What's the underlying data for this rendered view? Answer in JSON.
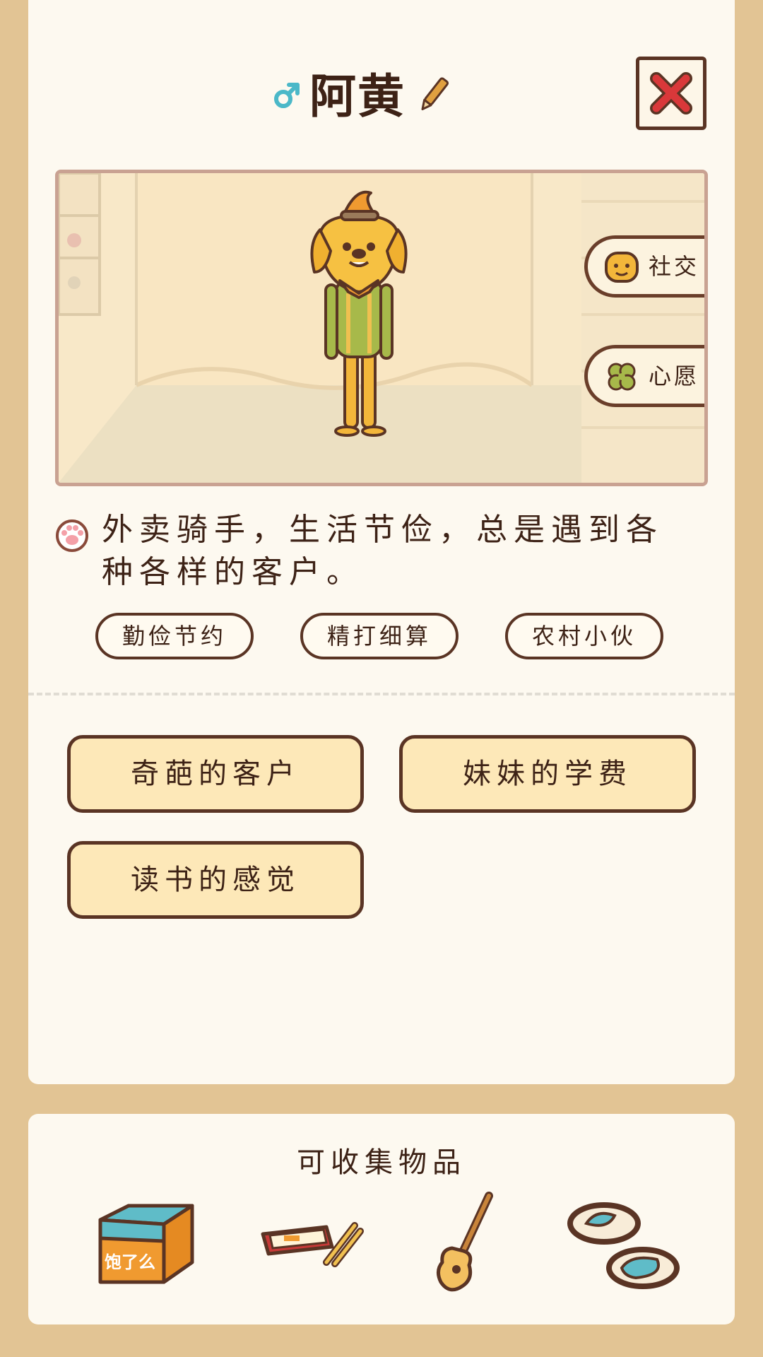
{
  "character": {
    "name": "阿黄",
    "gender_icon": "male-symbol-icon",
    "description": "外卖骑手，生活节俭，总是遇到各种各样的客户。",
    "tags": [
      "勤俭节约",
      "精打细算",
      "农村小伙"
    ]
  },
  "side_buttons": {
    "social_label": "社交",
    "wish_label": "心愿"
  },
  "stories": [
    "奇葩的客户",
    "妹妹的学费",
    "读书的感觉"
  ],
  "collectibles": {
    "title": "可收集物品",
    "items": [
      {
        "icon": "delivery-box-icon",
        "box_text": "饱了么"
      },
      {
        "icon": "lunchbox-chopsticks-icon"
      },
      {
        "icon": "guitar-icon"
      },
      {
        "icon": "slippers-icon"
      }
    ]
  },
  "colors": {
    "page_bg": "#e2c494",
    "card_bg": "#fdf9f0",
    "outline": "#5a3424",
    "button_fill": "#fde8b8",
    "close_red": "#d9383a",
    "male_blue": "#4bb8c8"
  }
}
